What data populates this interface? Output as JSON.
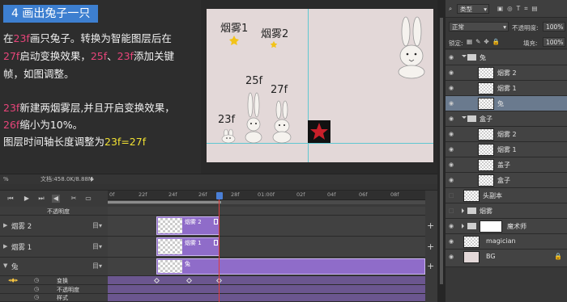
{
  "caption": {
    "badge": "4 画出兔子一只",
    "l1_a": "在",
    "l1_b": "23f",
    "l1_c": "画只兔子。转换为智能图层后在",
    "l2_a": "27f",
    "l2_b": "启动变换效果，",
    "l2_c": "25f",
    "l2_d": "、",
    "l2_e": "23f",
    "l2_f": "添加关键",
    "l3": "帧，如图调整。",
    "l4_a": "23f",
    "l4_b": "新建两烟雾层,并且开启变换效果，",
    "l5_a": "26f",
    "l5_b": "缩小为10%。",
    "l6_a": "图层时间轴长度调整为",
    "l6_b": "23f=27f"
  },
  "canvas": {
    "labels": {
      "smoke1": "烟雾1",
      "smoke2": "烟雾2",
      "f23": "23f",
      "f25": "25f",
      "f27": "27f"
    },
    "colors": {
      "doc_bg": "#e3d8d8",
      "guide": "#5fc7d1",
      "star": "#c8202a",
      "smoke": "#f2c318"
    }
  },
  "status": {
    "zoom": "%",
    "doc_info": "文档:458.0K/8.88M"
  },
  "timeline": {
    "ruler_ticks": [
      "0f",
      "22f",
      "24f",
      "26f",
      "28f",
      "01:00f",
      "02f",
      "04f",
      "06f",
      "08f"
    ],
    "opacity_label": "不透明度",
    "layers": [
      {
        "name": "烟雾 2",
        "clip_label": "烟雾 2"
      },
      {
        "name": "烟雾 1",
        "clip_label": "烟雾 1"
      },
      {
        "name": "兔",
        "clip_label": "兔"
      }
    ],
    "props": [
      "变换",
      "不透明度",
      "样式"
    ],
    "colors": {
      "clip": "#8f6cc9",
      "playhead": "#e23b3b"
    }
  },
  "layers_panel": {
    "kind_select": "类型",
    "blend_mode": "正常",
    "opacity_label": "不透明度:",
    "opacity_value": "100%",
    "lock_label": "锁定:",
    "fill_label": "填充:",
    "fill_value": "100%",
    "items": [
      {
        "name": "兔"
      },
      {
        "name": "烟雾 2"
      },
      {
        "name": "烟雾 1"
      },
      {
        "name": "兔"
      },
      {
        "name": "盒子"
      },
      {
        "name": "烟雾 2"
      },
      {
        "name": "烟雾 1"
      },
      {
        "name": "盖子"
      },
      {
        "name": "盒子"
      },
      {
        "name": "头副本"
      },
      {
        "name": "烟雾"
      },
      {
        "name": "魔术师"
      },
      {
        "name": "magician"
      },
      {
        "name": "BG"
      }
    ]
  }
}
